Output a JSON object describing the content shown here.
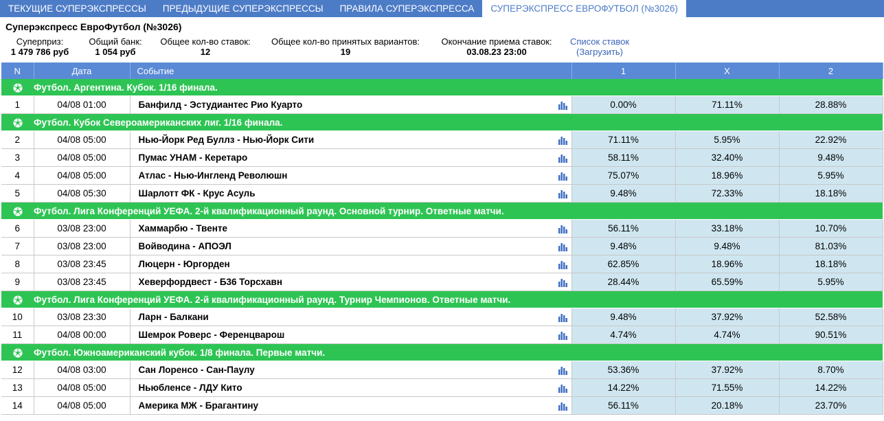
{
  "tabs": [
    {
      "label": "ТЕКУЩИЕ СУПЕРЭКСПРЕССЫ",
      "active": false
    },
    {
      "label": "ПРЕДЫДУЩИЕ СУПЕРЭКСПРЕССЫ",
      "active": false
    },
    {
      "label": "ПРАВИЛА СУПЕРЭКСПРЕССА",
      "active": false
    },
    {
      "label": "СУПЕРЭКСПРЕСС ЕВРОФУТБОЛ (№3026)",
      "active": true
    }
  ],
  "info": {
    "title": "Суперэкспресс ЕвроФутбол (№3026)",
    "superprize_label": "Суперприз:",
    "superprize_value": "1 479 786 руб",
    "bank_label": "Общий банк:",
    "bank_value": "1 054 руб",
    "bets_label": "Общее кол-во ставок:",
    "bets_value": "12",
    "variants_label": "Общее кол-во принятых вариантов:",
    "variants_value": "19",
    "deadline_label": "Окончание приема ставок:",
    "deadline_value": "03.08.23 23:00",
    "bets_list_link": "Список ставок",
    "load_link": "(Загрузить)"
  },
  "table": {
    "headers": {
      "n": "N",
      "date": "Дата",
      "event": "Событие",
      "c1": "1",
      "cx": "X",
      "c2": "2"
    },
    "rows": [
      {
        "type": "group",
        "title": "Футбол. Аргентина. Кубок. 1/16 финала."
      },
      {
        "type": "event",
        "n": "1",
        "date": "04/08 01:00",
        "event": "Банфилд - Эстудиантес Рио Куарто",
        "p1": "0.00%",
        "px": "71.11%",
        "p2": "28.88%"
      },
      {
        "type": "group",
        "title": "Футбол. Кубок Североамериканских лиг. 1/16 финала."
      },
      {
        "type": "event",
        "n": "2",
        "date": "04/08 05:00",
        "event": "Нью-Йорк Ред Буллз - Нью-Йорк Сити",
        "p1": "71.11%",
        "px": "5.95%",
        "p2": "22.92%"
      },
      {
        "type": "event",
        "n": "3",
        "date": "04/08 05:00",
        "event": "Пумас УНАМ - Керетаро",
        "p1": "58.11%",
        "px": "32.40%",
        "p2": "9.48%"
      },
      {
        "type": "event",
        "n": "4",
        "date": "04/08 05:00",
        "event": "Атлас - Нью-Ингленд Революшн",
        "p1": "75.07%",
        "px": "18.96%",
        "p2": "5.95%"
      },
      {
        "type": "event",
        "n": "5",
        "date": "04/08 05:30",
        "event": "Шарлотт ФК - Крус Асуль",
        "p1": "9.48%",
        "px": "72.33%",
        "p2": "18.18%"
      },
      {
        "type": "group",
        "title": "Футбол. Лига Конференций УЕФА. 2-й квалификационный раунд. Основной турнир. Ответные матчи."
      },
      {
        "type": "event",
        "n": "6",
        "date": "03/08 23:00",
        "event": "Хаммарбю - Твенте",
        "p1": "56.11%",
        "px": "33.18%",
        "p2": "10.70%"
      },
      {
        "type": "event",
        "n": "7",
        "date": "03/08 23:00",
        "event": "Войводина - АПОЭЛ",
        "p1": "9.48%",
        "px": "9.48%",
        "p2": "81.03%"
      },
      {
        "type": "event",
        "n": "8",
        "date": "03/08 23:45",
        "event": "Люцерн - Юргорден",
        "p1": "62.85%",
        "px": "18.96%",
        "p2": "18.18%"
      },
      {
        "type": "event",
        "n": "9",
        "date": "03/08 23:45",
        "event": "Хеверфордвест - Б36 Торсхавн",
        "p1": "28.44%",
        "px": "65.59%",
        "p2": "5.95%"
      },
      {
        "type": "group",
        "title": "Футбол. Лига Конференций УЕФА. 2-й квалификационный раунд. Турнир Чемпионов. Ответные матчи."
      },
      {
        "type": "event",
        "n": "10",
        "date": "03/08 23:30",
        "event": "Ларн - Балкани",
        "p1": "9.48%",
        "px": "37.92%",
        "p2": "52.58%"
      },
      {
        "type": "event",
        "n": "11",
        "date": "04/08 00:00",
        "event": "Шемрок Роверс - Ференцварош",
        "p1": "4.74%",
        "px": "4.74%",
        "p2": "90.51%"
      },
      {
        "type": "group",
        "title": "Футбол. Южноамериканский кубок. 1/8 финала. Первые матчи."
      },
      {
        "type": "event",
        "n": "12",
        "date": "04/08 03:00",
        "event": "Сан Лоренсо - Сан-Паулу",
        "p1": "53.36%",
        "px": "37.92%",
        "p2": "8.70%"
      },
      {
        "type": "event",
        "n": "13",
        "date": "04/08 05:00",
        "event": "Ньюбленсе - ЛДУ Кито",
        "p1": "14.22%",
        "px": "71.55%",
        "p2": "14.22%"
      },
      {
        "type": "event",
        "n": "14",
        "date": "04/08 05:00",
        "event": "Америка МЖ - Брагантину",
        "p1": "56.11%",
        "px": "20.18%",
        "p2": "23.70%"
      }
    ]
  }
}
